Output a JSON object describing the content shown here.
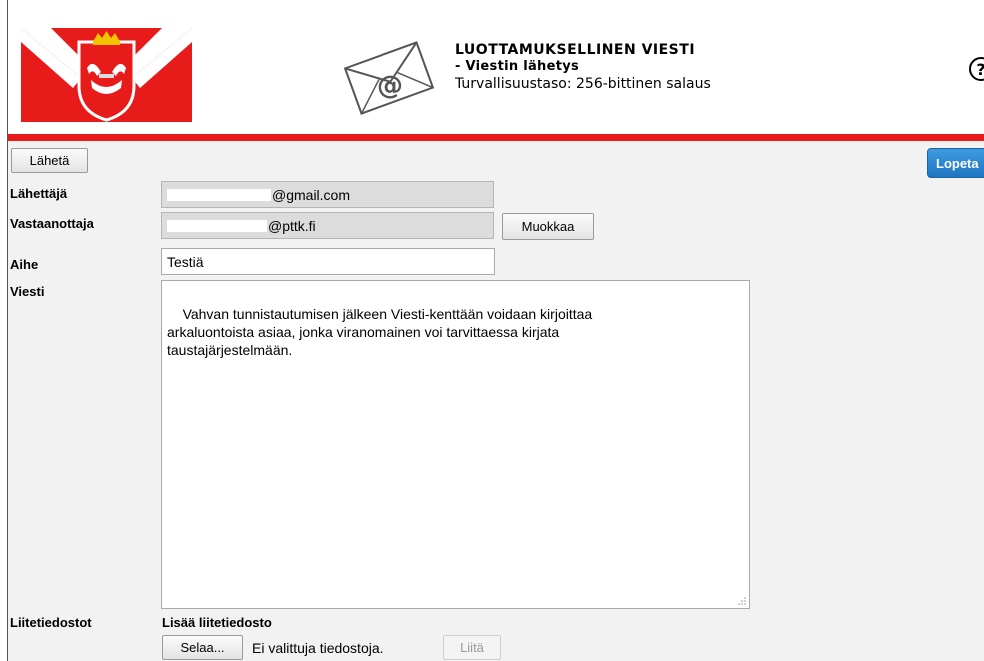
{
  "header": {
    "title": "LUOTTAMUKSELLINEN VIESTI",
    "subtitle": "- Viestin lähetys",
    "security": "Turvallisuustaso: 256-bittinen salaus",
    "help_symbol": "?",
    "accent_color": "#e81b1b"
  },
  "toolbar": {
    "send_label": "Lähetä",
    "quit_label": "Lopeta"
  },
  "form": {
    "sender": {
      "label": "Lähettäjä",
      "value": "@gmail.com"
    },
    "recipient": {
      "label": "Vastaanottaja",
      "value": "@pttk.fi",
      "edit_label": "Muokkaa"
    },
    "subject": {
      "label": "Aihe",
      "value": "Testiä"
    },
    "message": {
      "label": "Viesti",
      "value": "Vahvan tunnistautumisen jälkeen Viesti-kenttään voidaan kirjoittaa\narkaluontoista asiaa, jonka viranomainen voi tarvittaessa kirjata\ntaustajärjestelmään."
    },
    "attachments": {
      "label": "Liitetiedostot",
      "add_heading": "Lisää liitetiedosto",
      "browse_label": "Selaa...",
      "file_status": "Ei valittuja tiedostoja.",
      "attach_label": "Liitä"
    }
  },
  "icons": [
    "coat-of-arms-logo",
    "email-icon",
    "help-icon",
    "resize-handle-icon"
  ]
}
